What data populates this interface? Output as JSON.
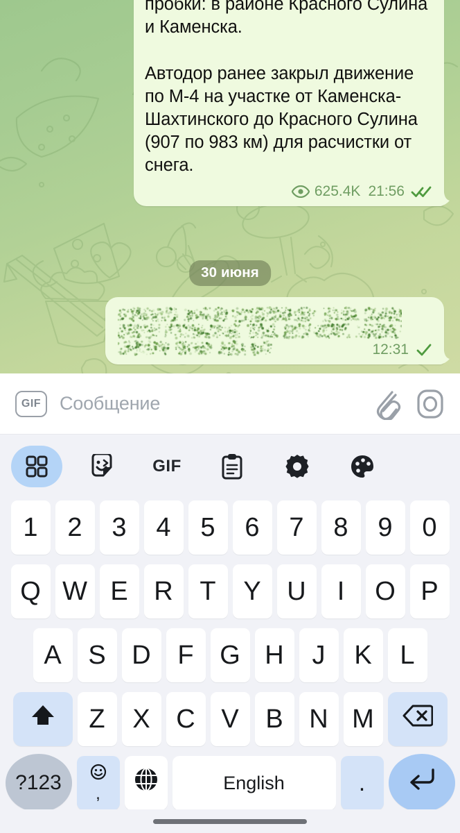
{
  "app": {
    "name": "Telegram",
    "screen": "chat-conversation-with-keyboard"
  },
  "colors": {
    "bubble_outgoing": "#effadf",
    "chat_bg_top": "#9ec88e",
    "chat_bg_bottom": "#cfdba4",
    "meta_green": "#6f9d62",
    "tick_green": "#4e9a3e",
    "keyboard_bg": "#f1f2f7",
    "key_white": "#ffffff",
    "key_mod_blue": "#d4e3f8",
    "key_shift_blue": "#d4e3f8",
    "key_enter_blue": "#a8caf4",
    "key_sym_grey": "#bdc6d3",
    "toolbar_active_blue": "#b4d4f7",
    "placeholder_grey": "#9fa6ae"
  },
  "chat": {
    "messages": [
      {
        "id": "msg-1",
        "type": "text",
        "outgoing": true,
        "text": "момент расвора явля…\nдва пункта в начале и конце пробки: в районе Красного Сулина и Каменска.\n\nАвтодор ранее закрыл движение по М-4 на участке от Каменска-Шахтинского до Красного Сулина (907 по 983 км) для расчистки от снега.",
        "views_icon": "eye-icon",
        "views": "625.4K",
        "time": "21:56",
        "status_icon": "double-check-icon"
      },
      {
        "id": "msg-2",
        "type": "spoiler",
        "outgoing": true,
        "text": "",
        "spoiler_hidden": true,
        "time": "12:31",
        "status_icon": "single-check-icon"
      }
    ],
    "date_separator": "30 июня"
  },
  "input_bar": {
    "gif_button_label": "GIF",
    "placeholder": "Сообщение",
    "attach_icon": "paperclip-icon",
    "camera_icon": "camera-round-icon"
  },
  "keyboard": {
    "toolbar": [
      {
        "name": "apps-grid-icon",
        "label": "",
        "active": true
      },
      {
        "name": "sticker-icon",
        "label": "",
        "active": false
      },
      {
        "name": "gif-icon",
        "label": "GIF",
        "active": false
      },
      {
        "name": "clipboard-icon",
        "label": "",
        "active": false
      },
      {
        "name": "gear-icon",
        "label": "",
        "active": false
      },
      {
        "name": "palette-icon",
        "label": "",
        "active": false
      }
    ],
    "row_numbers": [
      "1",
      "2",
      "3",
      "4",
      "5",
      "6",
      "7",
      "8",
      "9",
      "0"
    ],
    "row_qwerty": [
      "Q",
      "W",
      "E",
      "R",
      "T",
      "Y",
      "U",
      "I",
      "O",
      "P"
    ],
    "row_asdf": [
      "A",
      "S",
      "D",
      "F",
      "G",
      "H",
      "J",
      "K",
      "L"
    ],
    "row_zxcv": [
      "Z",
      "X",
      "C",
      "V",
      "B",
      "N",
      "M"
    ],
    "shift_key": {
      "name": "shift-key",
      "icon": "shift-arrow-icon"
    },
    "backspace_key": {
      "name": "backspace-key",
      "icon": "backspace-icon"
    },
    "symbols_key": {
      "name": "symbols-key",
      "label": "?123"
    },
    "emoji_key": {
      "name": "emoji-comma-key",
      "icon": "smiley-icon",
      "sub_label": ","
    },
    "globe_key": {
      "name": "language-globe-key",
      "icon": "globe-icon"
    },
    "space_key": {
      "name": "space-key",
      "label": "English"
    },
    "period_key": {
      "name": "period-key",
      "label": "."
    },
    "enter_key": {
      "name": "enter-key",
      "icon": "enter-arrow-icon"
    }
  },
  "system": {
    "nav_pill": "home-indicator"
  }
}
